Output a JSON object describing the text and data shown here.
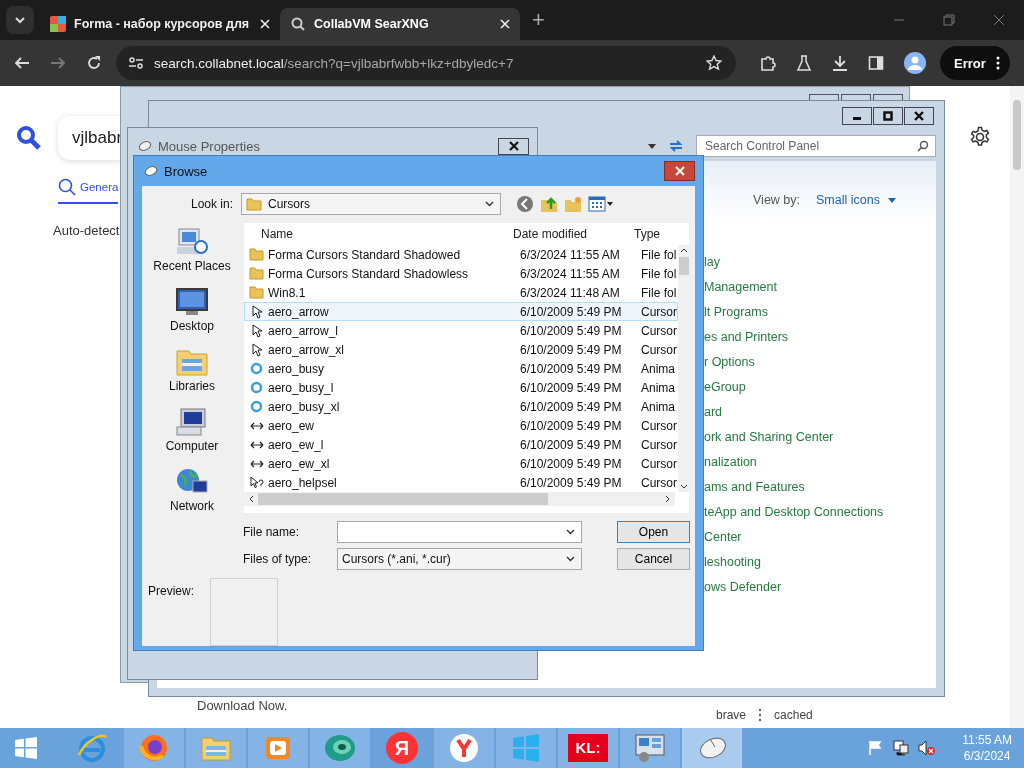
{
  "browser": {
    "tabs": [
      {
        "title": "Forma - набор курсоров для",
        "selected": false
      },
      {
        "title": "CollabVM SearXNG",
        "selected": true
      }
    ],
    "new_tab": "+",
    "url_host": "search.collabnet.local",
    "url_path": "/search?q=vjlbabrfwbb+lkz+dbyledc+7",
    "profile_button": "Error"
  },
  "page": {
    "query": "vjlbabr",
    "category_tab": "Genera",
    "language": "Auto-detect",
    "footer_link": "Download Now.",
    "engines": [
      "brave",
      "cached"
    ]
  },
  "control_panel": {
    "search_placeholder": "Search Control Panel",
    "view_by_label": "View by:",
    "view_by_value": "Small icons",
    "items": [
      "lay",
      "Management",
      "lt Programs",
      "es and Printers",
      "r Options",
      "eGroup",
      "ard",
      "ork and Sharing Center",
      "nalization",
      "ams and Features",
      "teApp and Desktop Connections",
      "Center",
      "leshooting",
      "ows Defender"
    ]
  },
  "mouse_properties": {
    "title": "Mouse Properties"
  },
  "browse": {
    "title": "Browse",
    "look_in_label": "Look in:",
    "look_in": "Cursors",
    "places": [
      "Recent Places",
      "Desktop",
      "Libraries",
      "Computer",
      "Network"
    ],
    "columns": [
      "Name",
      "Date modified",
      "Type"
    ],
    "files": [
      {
        "name": "Forma Cursors Standard Shadowed",
        "date": "6/3/2024 11:55 AM",
        "type": "File fol",
        "kind": "folder",
        "selected": false
      },
      {
        "name": "Forma Cursors Standard Shadowless",
        "date": "6/3/2024 11:55 AM",
        "type": "File fol",
        "kind": "folder",
        "selected": false
      },
      {
        "name": "Win8.1",
        "date": "6/3/2024 11:48 AM",
        "type": "File fol",
        "kind": "folder",
        "selected": false
      },
      {
        "name": "aero_arrow",
        "date": "6/10/2009 5:49 PM",
        "type": "Cursor",
        "kind": "arrow",
        "selected": true
      },
      {
        "name": "aero_arrow_l",
        "date": "6/10/2009 5:49 PM",
        "type": "Cursor",
        "kind": "arrow",
        "selected": false
      },
      {
        "name": "aero_arrow_xl",
        "date": "6/10/2009 5:49 PM",
        "type": "Cursor",
        "kind": "arrow",
        "selected": false
      },
      {
        "name": "aero_busy",
        "date": "6/10/2009 5:49 PM",
        "type": "Anima",
        "kind": "busy",
        "selected": false
      },
      {
        "name": "aero_busy_l",
        "date": "6/10/2009 5:49 PM",
        "type": "Anima",
        "kind": "busy",
        "selected": false
      },
      {
        "name": "aero_busy_xl",
        "date": "6/10/2009 5:49 PM",
        "type": "Anima",
        "kind": "busy",
        "selected": false
      },
      {
        "name": "aero_ew",
        "date": "6/10/2009 5:49 PM",
        "type": "Cursor",
        "kind": "resize",
        "selected": false
      },
      {
        "name": "aero_ew_l",
        "date": "6/10/2009 5:49 PM",
        "type": "Cursor",
        "kind": "resize",
        "selected": false
      },
      {
        "name": "aero_ew_xl",
        "date": "6/10/2009 5:49 PM",
        "type": "Cursor",
        "kind": "resize",
        "selected": false
      },
      {
        "name": "aero_helpsel",
        "date": "6/10/2009 5:49 PM",
        "type": "Cursor",
        "kind": "help",
        "selected": false
      }
    ],
    "file_name_label": "File name:",
    "file_type_label": "Files of type:",
    "file_type": "Cursors (*.ani, *.cur)",
    "buttons": [
      "Open",
      "Cancel"
    ],
    "preview_label": "Preview:"
  },
  "taskbar": {
    "apps": [
      {
        "kind": "ie",
        "running": false,
        "active": false
      },
      {
        "kind": "firefox",
        "running": true,
        "active": false
      },
      {
        "kind": "explorer",
        "running": true,
        "active": false
      },
      {
        "kind": "media",
        "running": true,
        "active": false
      },
      {
        "kind": "disc",
        "running": true,
        "active": false
      },
      {
        "kind": "yandex",
        "glyph": "Я",
        "running": false,
        "active": false
      },
      {
        "kind": "ybrowser",
        "running": true,
        "active": false
      },
      {
        "kind": "store",
        "running": true,
        "active": false
      },
      {
        "kind": "kl",
        "glyph": "KL:",
        "running": true,
        "active": false
      },
      {
        "kind": "controlpanel",
        "running": true,
        "active": false
      },
      {
        "kind": "mouse",
        "running": true,
        "active": true
      }
    ],
    "time": "11:55 AM",
    "date": "6/3/2024"
  }
}
